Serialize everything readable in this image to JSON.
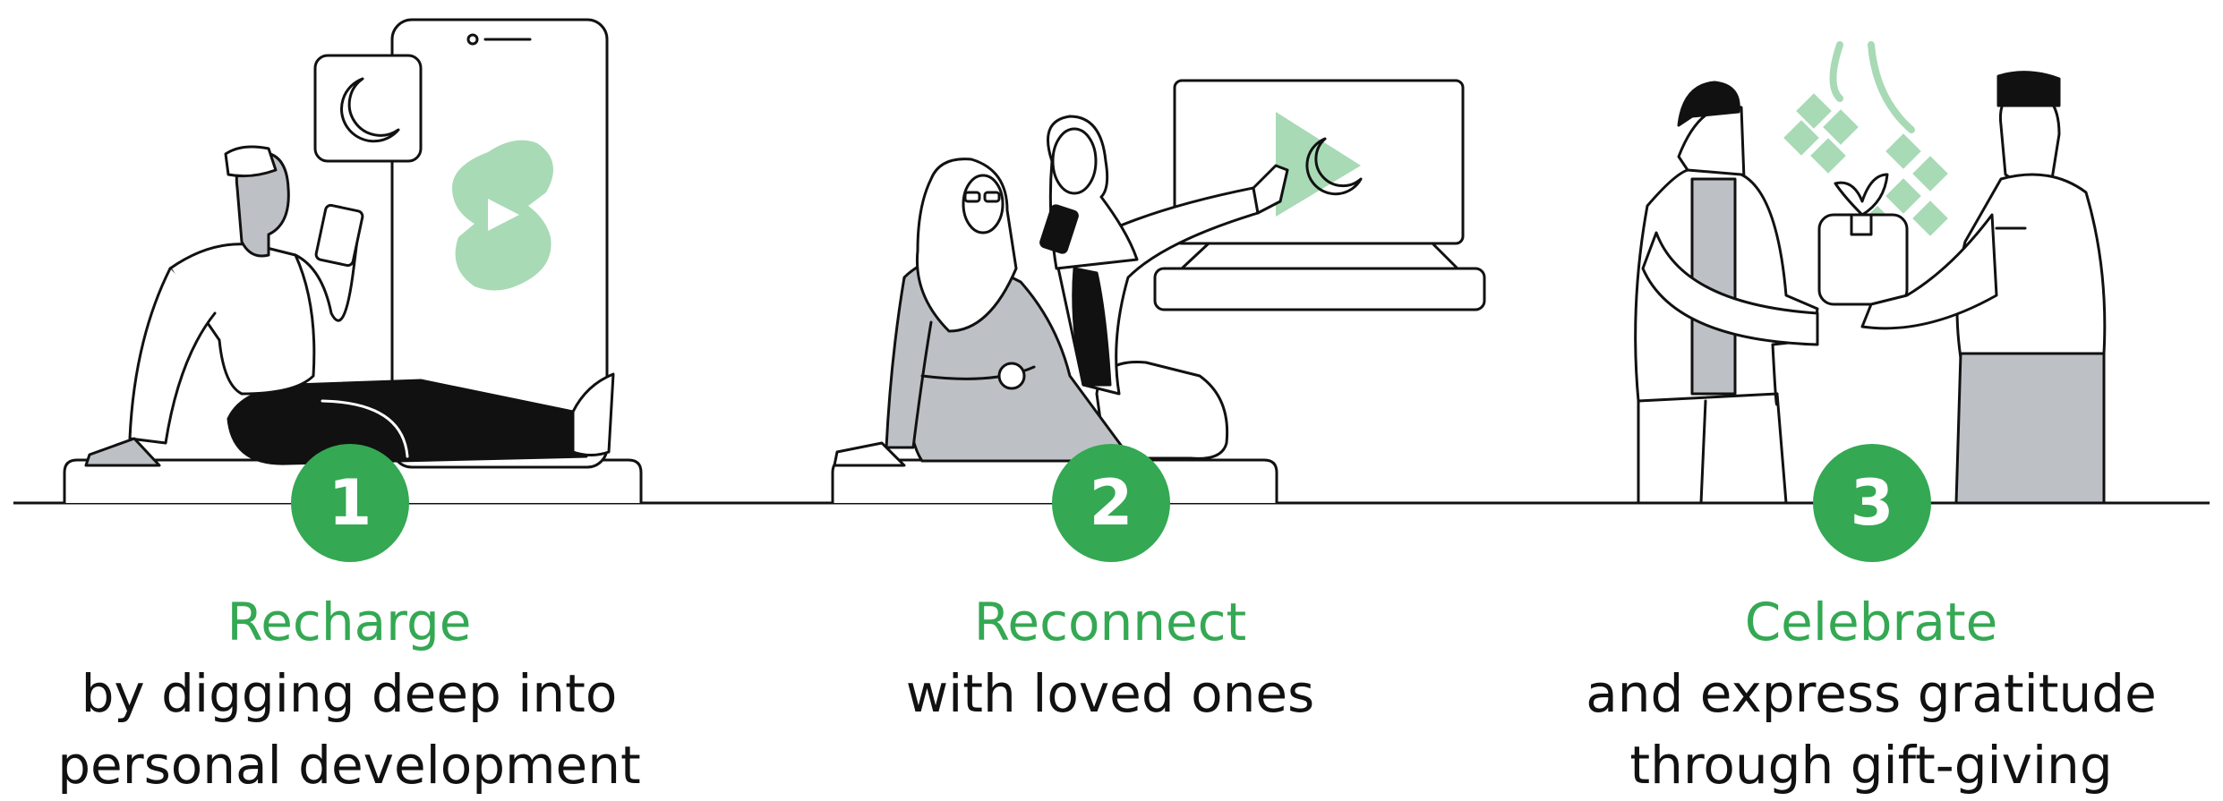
{
  "colors": {
    "accent": "#34a853",
    "accent_light": "#a8dab5",
    "figure_gray": "#bdc1c6",
    "ink": "#111111"
  },
  "steps": [
    {
      "number": "1",
      "heading": "Recharge",
      "description": [
        "by digging deep into",
        "personal development"
      ]
    },
    {
      "number": "2",
      "heading": "Reconnect",
      "description": [
        "with loved ones"
      ]
    },
    {
      "number": "3",
      "heading": "Celebrate",
      "description": [
        "and express gratitude",
        "through gift-giving"
      ]
    }
  ],
  "icons": {
    "crescent": "crescent-moon-icon",
    "shorts": "youtube-shorts-icon",
    "play": "play-icon",
    "gift": "gift-box-icon",
    "ketupat": "ketupat-decoration-icon"
  }
}
